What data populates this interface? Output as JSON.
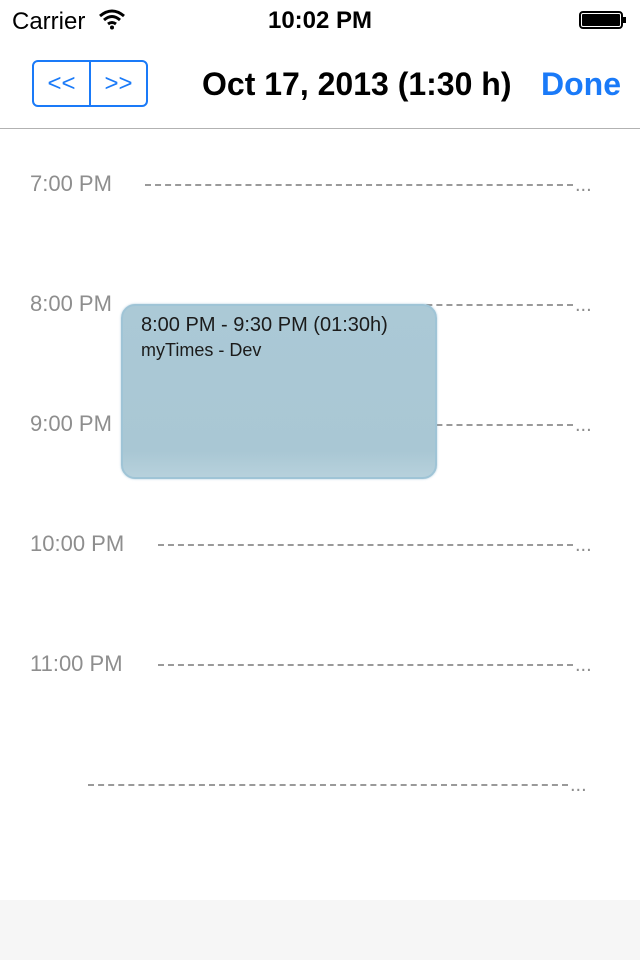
{
  "status_bar": {
    "carrier": "Carrier",
    "time": "10:02 PM",
    "icons": [
      "wifi-icon",
      "battery-icon"
    ]
  },
  "nav": {
    "prev_label": "<<",
    "next_label": ">>",
    "title": "Oct 17, 2013 (1:30 h)",
    "done_label": "Done",
    "accent_color": "#1a7af8"
  },
  "timeline": {
    "hours": [
      "7:00 PM",
      "8:00 PM",
      "9:00 PM",
      "10:00 PM",
      "11:00 PM"
    ],
    "ellipsis": "..."
  },
  "event": {
    "time_range": "8:00 PM - 9:30 PM (01:30h)",
    "name": "myTimes - Dev",
    "color": "#abc9d6"
  }
}
